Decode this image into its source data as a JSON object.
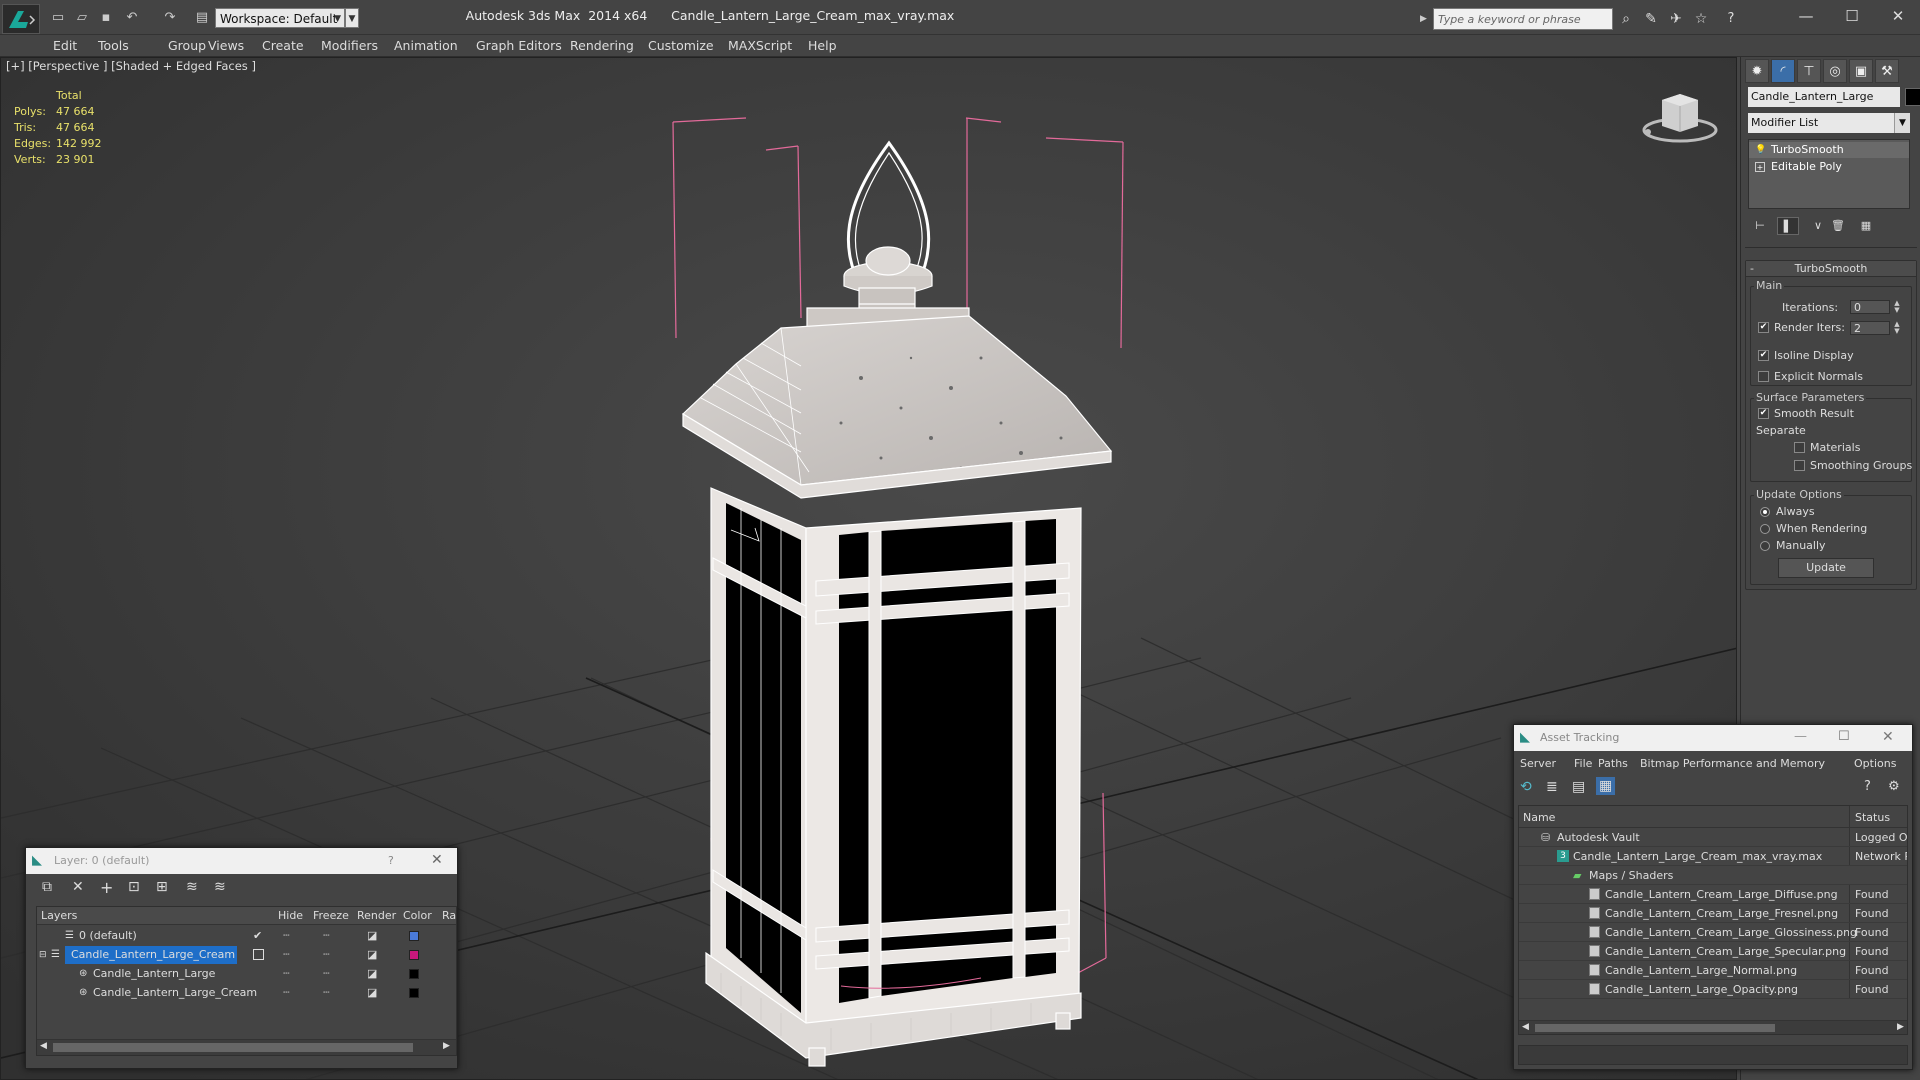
{
  "app": {
    "title_left": "Autodesk 3ds Max  2014 x64",
    "title_right": "Candle_Lantern_Large_Cream_max_vray.max",
    "workspace": "Workspace: Default",
    "search_placeholder": "Type a keyword or phrase"
  },
  "menu": [
    "Edit",
    "Tools",
    "Group",
    "Views",
    "Create",
    "Modifiers",
    "Animation",
    "Graph Editors",
    "Rendering",
    "Customize",
    "MAXScript",
    "Help"
  ],
  "viewport": {
    "label": "[+] [Perspective ] [Shaded + Edged Faces ]",
    "stats": {
      "header": "Total",
      "rows": [
        {
          "label": "Polys:",
          "value": "47 664"
        },
        {
          "label": "Tris:",
          "value": "47 664"
        },
        {
          "label": "Edges:",
          "value": "142 992"
        },
        {
          "label": "Verts:",
          "value": "23 901"
        }
      ]
    }
  },
  "command_panel": {
    "object_name": "Candle_Lantern_Large",
    "object_color": "#000000",
    "modifier_list": "Modifier List",
    "stack": [
      "TurboSmooth",
      "Editable Poly"
    ],
    "rollout_title": "TurboSmooth",
    "main": {
      "label": "Main",
      "iterations_label": "Iterations:",
      "iterations_value": "0",
      "render_iters_label": "Render Iters:",
      "render_iters_value": "2",
      "isoline_display": "Isoline Display",
      "explicit_normals": "Explicit Normals"
    },
    "surface": {
      "label": "Surface Parameters",
      "smooth_result": "Smooth Result",
      "separate": "Separate",
      "materials": "Materials",
      "smoothing_groups": "Smoothing Groups"
    },
    "update": {
      "label": "Update Options",
      "always": "Always",
      "when_rendering": "When Rendering",
      "manually": "Manually",
      "button": "Update"
    }
  },
  "layer_window": {
    "title": "Layer: 0 (default)",
    "help": "?",
    "columns": [
      "Layers",
      "Hide",
      "Freeze",
      "Render",
      "Color",
      "Ra"
    ],
    "rows": [
      {
        "name": "0 (default)",
        "color": "#4a7ad8",
        "indent": 1,
        "selected": false,
        "current": true
      },
      {
        "name": "Candle_Lantern_Large_Cream",
        "color": "#c8187c",
        "indent": 0,
        "selected": true,
        "current": false
      },
      {
        "name": "Candle_Lantern_Large",
        "color": "#000000",
        "indent": 2,
        "selected": false,
        "current": false
      },
      {
        "name": "Candle_Lantern_Large_Cream",
        "color": "#000000",
        "indent": 2,
        "selected": false,
        "current": false
      }
    ]
  },
  "asset_window": {
    "title": "Asset Tracking",
    "menu": [
      "Server",
      "File",
      "Paths",
      "Bitmap Performance and Memory",
      "Options"
    ],
    "columns": [
      "Name",
      "Status"
    ],
    "rows": [
      {
        "name": "Autodesk Vault",
        "status": "Logged O",
        "level": 1,
        "kind": "vault"
      },
      {
        "name": "Candle_Lantern_Large_Cream_max_vray.max",
        "status": "Network P",
        "level": 2,
        "kind": "max"
      },
      {
        "name": "Maps / Shaders",
        "status": "",
        "level": 3,
        "kind": "folder"
      },
      {
        "name": "Candle_Lantern_Cream_Large_Diffuse.png",
        "status": "Found",
        "level": 4,
        "kind": "file"
      },
      {
        "name": "Candle_Lantern_Cream_Large_Fresnel.png",
        "status": "Found",
        "level": 4,
        "kind": "file"
      },
      {
        "name": "Candle_Lantern_Cream_Large_Glossiness.png",
        "status": "Found",
        "level": 4,
        "kind": "file"
      },
      {
        "name": "Candle_Lantern_Cream_Large_Specular.png",
        "status": "Found",
        "level": 4,
        "kind": "file"
      },
      {
        "name": "Candle_Lantern_Large_Normal.png",
        "status": "Found",
        "level": 4,
        "kind": "file"
      },
      {
        "name": "Candle_Lantern_Large_Opacity.png",
        "status": "Found",
        "level": 4,
        "kind": "file"
      }
    ]
  }
}
